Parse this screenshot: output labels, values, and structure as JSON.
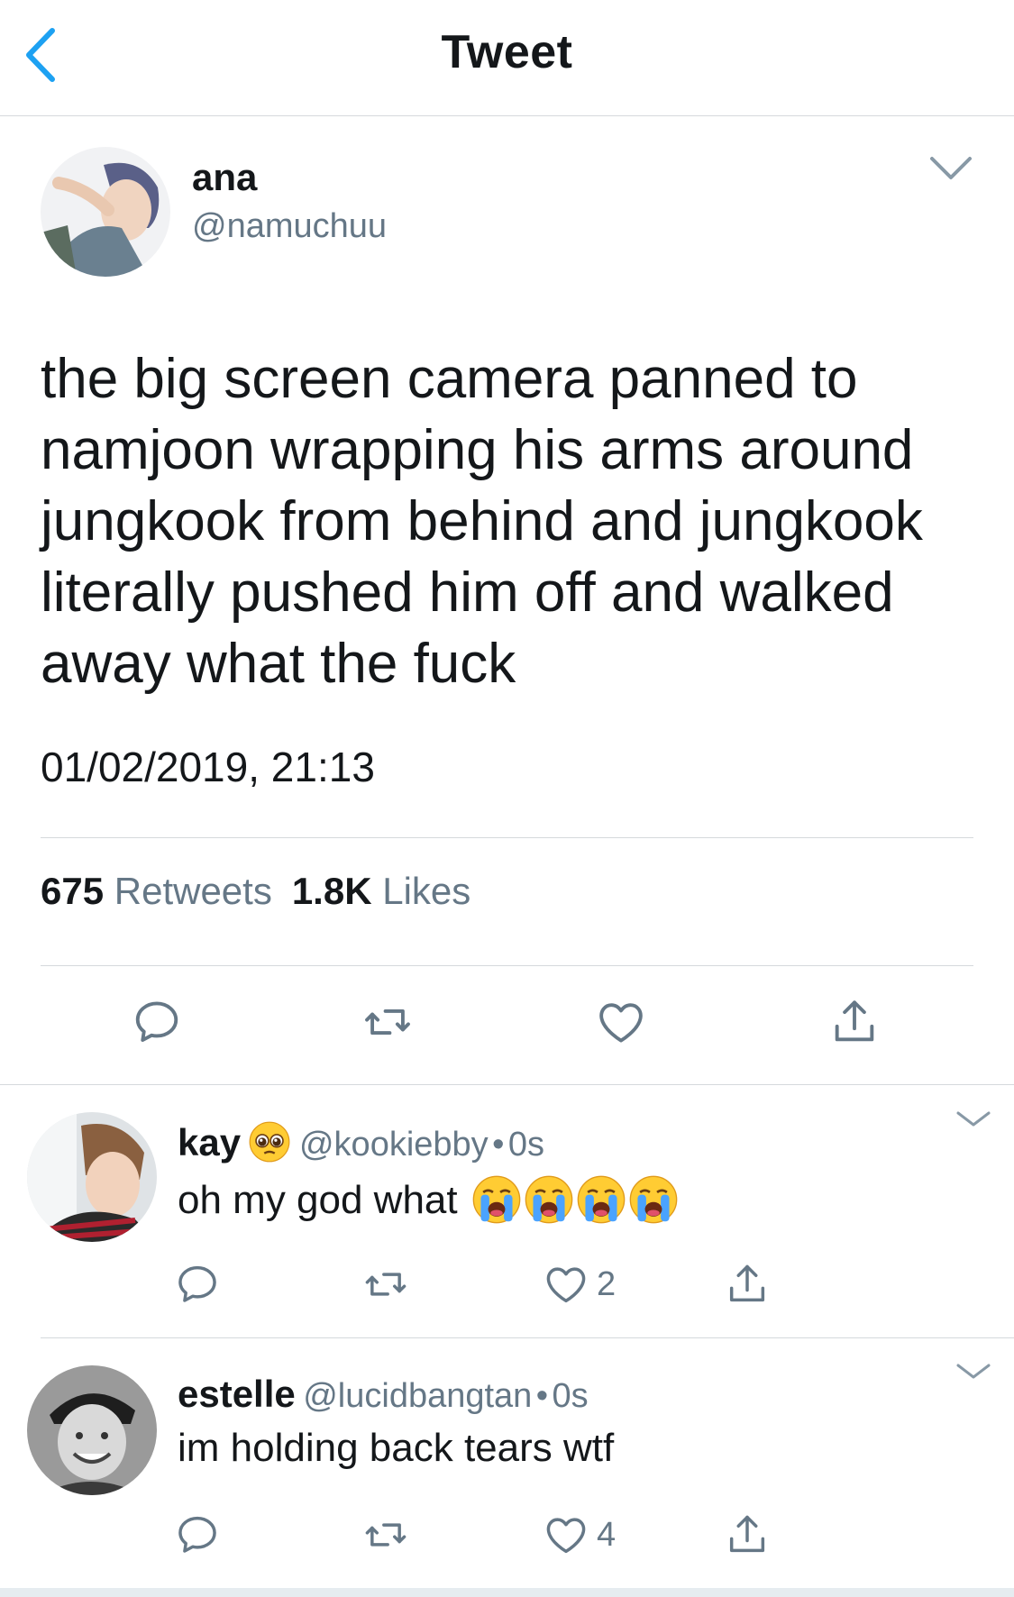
{
  "header": {
    "title": "Tweet",
    "back_icon": "chevron-left-icon"
  },
  "tweet": {
    "author": {
      "name": "ana",
      "handle": "@namuchuu"
    },
    "text": "the big screen camera panned to namjoon wrapping his arms around jungkook from behind and jungkook literally pushed him off and walked away what the fuck",
    "timestamp": "01/02/2019, 21:13",
    "stats": {
      "retweets_count": "675",
      "retweets_label": "Retweets",
      "likes_count": "1.8K",
      "likes_label": "Likes"
    },
    "actions": [
      "reply-icon",
      "retweet-icon",
      "like-icon",
      "share-icon"
    ]
  },
  "replies": [
    {
      "name": "kay",
      "handle": "@kookiebby",
      "time": "0s",
      "separator": "•",
      "text": "oh my god what",
      "name_emoji": "pleading-face",
      "text_emojis": [
        "loudly-crying-face",
        "loudly-crying-face",
        "loudly-crying-face",
        "loudly-crying-face"
      ],
      "likes": "2"
    },
    {
      "name": "estelle",
      "handle": "@lucidbangtan",
      "time": "0s",
      "separator": "•",
      "text": "im holding back tears wtf",
      "likes": "4"
    }
  ],
  "colors": {
    "accent": "#1da1f2",
    "secondary_text": "#657786",
    "primary_text": "#14171a",
    "divider": "#d5d9dc"
  }
}
